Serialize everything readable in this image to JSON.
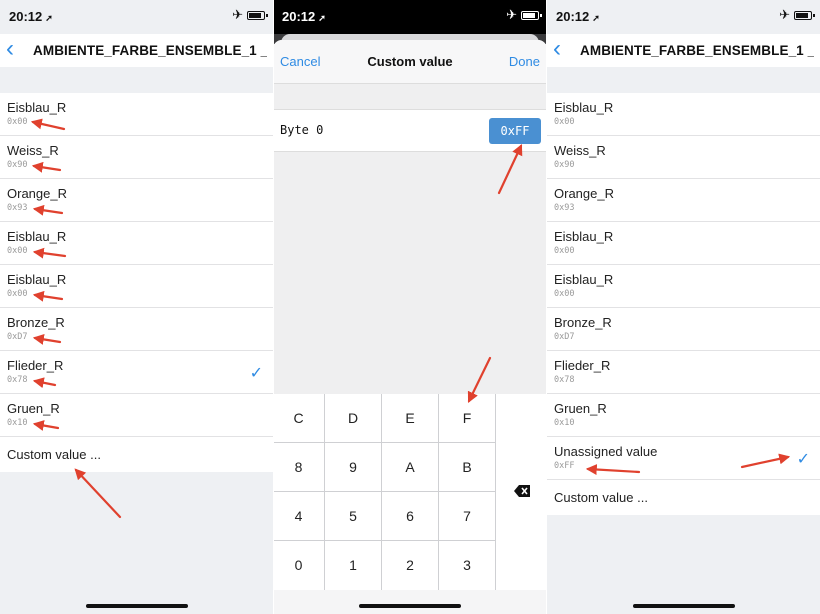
{
  "status_time": "20:12",
  "status_location_icon": "location-arrow-icon",
  "status_plane_icon": "airplane-icon",
  "nav_title": "AMBIENTE_FARBE_ENSEMBLE_1 _L...",
  "options": [
    {
      "name": "Eisblau_R",
      "value": "0x00"
    },
    {
      "name": "Weiss_R",
      "value": "0x90"
    },
    {
      "name": "Orange_R",
      "value": "0x93"
    },
    {
      "name": "Eisblau_R",
      "value": "0x00"
    },
    {
      "name": "Eisblau_R",
      "value": "0x00"
    },
    {
      "name": "Bronze_R",
      "value": "0xD7"
    },
    {
      "name": "Flieder_R",
      "value": "0x78"
    },
    {
      "name": "Gruen_R",
      "value": "0x10"
    }
  ],
  "unassigned": {
    "name": "Unassigned value",
    "value": "0xFF"
  },
  "custom_value_label": "Custom value ...",
  "custom_sheet": {
    "cancel": "Cancel",
    "title": "Custom value",
    "done": "Done",
    "byte_label": "Byte 0",
    "byte_value": "0xFF"
  },
  "keypad": {
    "keys": [
      "C",
      "D",
      "E",
      "F",
      "8",
      "9",
      "A",
      "B",
      "4",
      "5",
      "6",
      "7",
      "0",
      "1",
      "2",
      "3"
    ],
    "backspace_icon": "backspace-icon"
  },
  "colors": {
    "accent": "#2f8be3",
    "annotation_arrow": "#e0412e",
    "byte_value_bg": "#4a90d2"
  }
}
